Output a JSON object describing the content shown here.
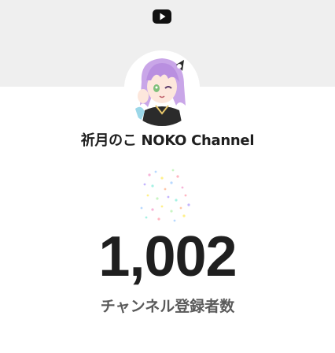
{
  "header": {
    "logo_icon": "youtube-logo-icon"
  },
  "channel": {
    "avatar_icon": "channel-avatar-anime-girl",
    "name": "祈月のこ NOKO Channel"
  },
  "subscribers": {
    "count": "1,002",
    "label": "チャンネル登録者数"
  },
  "colors": {
    "banner": "#efefef",
    "text_primary": "#1f1f1f",
    "text_secondary": "#5a5a5a",
    "hair": "#c9a6e8"
  }
}
